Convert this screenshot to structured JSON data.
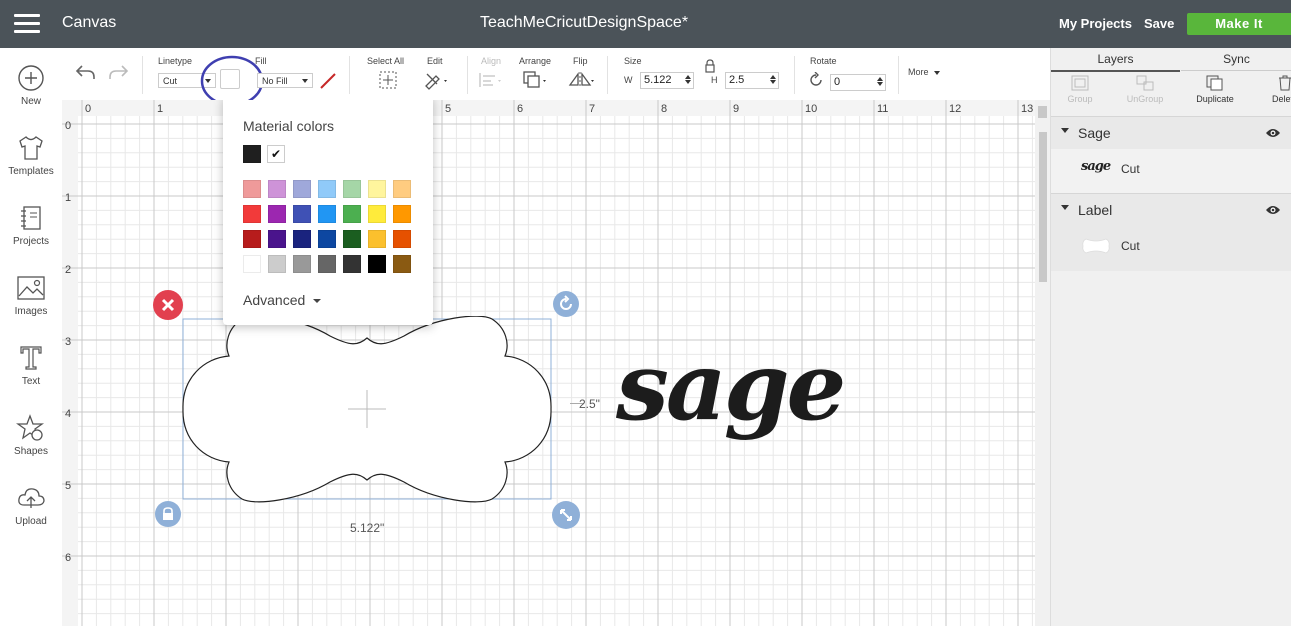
{
  "header": {
    "app_title": "Canvas",
    "document_title": "TeachMeCricutDesignSpace*",
    "my_projects": "My Projects",
    "save": "Save",
    "make_it": "Make It"
  },
  "sidebar": {
    "items": [
      {
        "label": "New",
        "icon": "plus-circle-icon"
      },
      {
        "label": "Templates",
        "icon": "shirt-icon"
      },
      {
        "label": "Projects",
        "icon": "notebook-icon"
      },
      {
        "label": "Images",
        "icon": "image-icon"
      },
      {
        "label": "Text",
        "icon": "text-t-icon"
      },
      {
        "label": "Shapes",
        "icon": "shapes-icon"
      },
      {
        "label": "Upload",
        "icon": "cloud-upload-icon"
      }
    ]
  },
  "toolbar": {
    "linetype_label": "Linetype",
    "linetype_value": "Cut",
    "fill_label": "Fill",
    "fill_value": "No Fill",
    "select_all": "Select All",
    "edit": "Edit",
    "align": "Align",
    "arrange": "Arrange",
    "flip": "Flip",
    "size_label": "Size",
    "w_label": "W",
    "w_value": "5.122",
    "h_label": "H",
    "h_value": "2.5",
    "rotate_label": "Rotate",
    "rotate_value": "0",
    "more": "More"
  },
  "ruler": {
    "x_ticks": [
      "0",
      "1",
      "2",
      "3",
      "4",
      "5",
      "6",
      "7",
      "8",
      "9",
      "10",
      "11",
      "12",
      "13"
    ],
    "y_ticks": [
      "0",
      "1",
      "2",
      "3",
      "4",
      "5",
      "6"
    ]
  },
  "canvas": {
    "height_dimension": "2.5\"",
    "width_dimension": "5.122\"",
    "text_object": "sage"
  },
  "color_popup": {
    "title": "Material colors",
    "advanced": "Advanced",
    "top_swatch": "#1f1f1f",
    "swatch_rows": [
      [
        "#ef9a9a",
        "#ce93d8",
        "#9fa8da",
        "#90caf9",
        "#a5d6a7",
        "#fff59d",
        "#ffcc80"
      ],
      [
        "#f23a3a",
        "#9c27b0",
        "#3f51b5",
        "#2196f3",
        "#4caf50",
        "#ffeb3b",
        "#ff9800"
      ],
      [
        "#b71c1c",
        "#4a148c",
        "#1a237e",
        "#0d47a1",
        "#1b5e20",
        "#fbc02d",
        "#e65100"
      ],
      [
        "#ffffff",
        "#cccccc",
        "#999999",
        "#666666",
        "#333333",
        "#000000",
        "#8a5a12"
      ]
    ]
  },
  "right_panel": {
    "tabs": [
      "Layers",
      "Sync"
    ],
    "actions": [
      "Group",
      "UnGroup",
      "Duplicate",
      "Delete"
    ],
    "layers": [
      {
        "name": "Sage",
        "item_label": "Cut",
        "thumb_text": "sage"
      },
      {
        "name": "Label",
        "item_label": "Cut"
      }
    ]
  },
  "colors": {
    "header_bg": "#4b5359",
    "make_it_green": "#59b63b",
    "highlight_circle": "#3f3fb0",
    "delete_red": "#e2404f",
    "handle_blue": "#8fb0d8"
  }
}
